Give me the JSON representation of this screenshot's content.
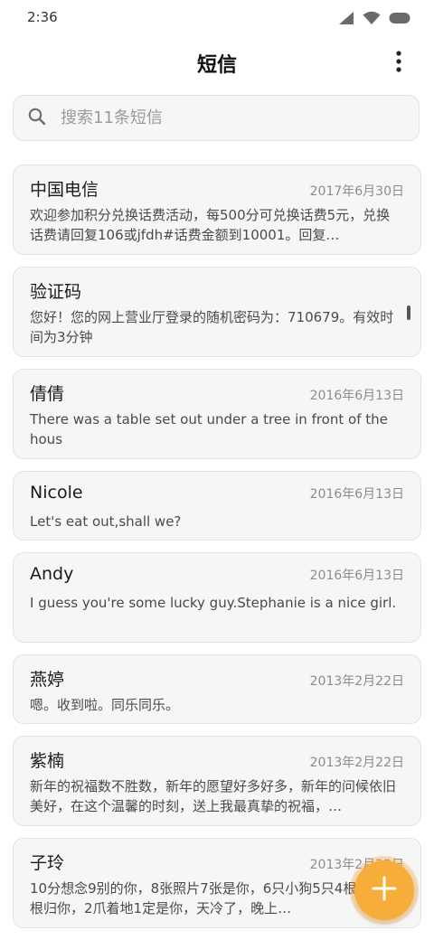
{
  "status_bar": {
    "time": "2:36",
    "icons": [
      "signal-icon",
      "wifi-icon",
      "battery-icon"
    ]
  },
  "header": {
    "title": "短信",
    "more_icon": "more-vertical-icon"
  },
  "search": {
    "placeholder": "搜索11条短信",
    "icon": "search-icon"
  },
  "messages": [
    {
      "sender": "中国电信",
      "date": "2017年6月30日",
      "preview": "欢迎参加积分兑换话费活动，每500分可兑换话费5元，兑换话费请回复106或jfdh#话费金额到10001。回复…"
    },
    {
      "sender": "验证码",
      "date": "",
      "preview": "您好！您的网上营业厅登录的随机密码为：710679。有效时间为3分钟"
    },
    {
      "sender": "倩倩",
      "date": "2016年6月13日",
      "preview": "There was a table set out under a tree in front of the hous"
    },
    {
      "sender": "Nicole",
      "date": "2016年6月13日",
      "preview": "Let's eat out,shall we?"
    },
    {
      "sender": "Andy",
      "date": "2016年6月13日",
      "preview": "I guess you're some lucky guy.Stephanie is a nice girl."
    },
    {
      "sender": "燕婷",
      "date": "2013年2月22日",
      "preview": "嗯。收到啦。同乐同乐。"
    },
    {
      "sender": "紫楠",
      "date": "2013年2月22日",
      "preview": "新年的祝福数不胜数，新年的愿望好多好多，新年的问候依旧美好，在这个温馨的时刻，送上我最真挚的祝福，…"
    },
    {
      "sender": "子玲",
      "date": "2013年2月22日",
      "preview": "10分想念9别的你，8张照片7张是你，6只小狗5只4根骨头3根归你，2爪着地1定是你，天冷了，晚上…"
    }
  ],
  "fab": {
    "icon": "plus-icon",
    "color": "#f7ad3a"
  },
  "colors": {
    "card_bg": "#f6f6f6",
    "accent": "#f7ad3a"
  }
}
